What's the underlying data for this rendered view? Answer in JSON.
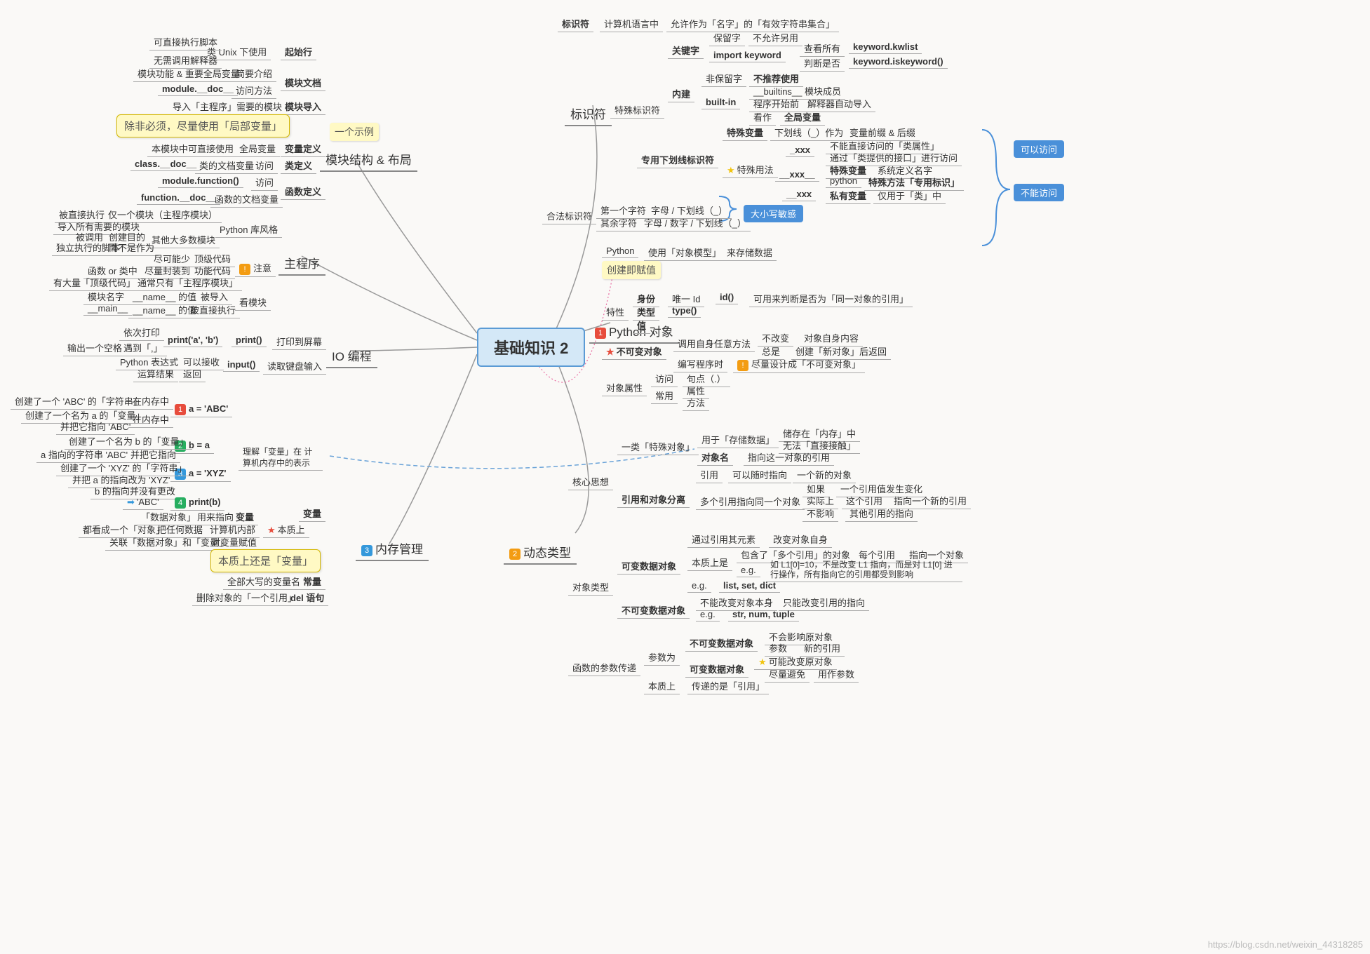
{
  "center": "基础知识 2",
  "watermark": "https://blog.csdn.net/weixin_44318285",
  "left": {
    "module": {
      "label": "模块结构 & 布局",
      "example": "一个示例",
      "local_var_callout": "除非必须，尽量使用「局部变量」",
      "start_line": {
        "label": "起始行",
        "unix": "类 Unix 下使用",
        "exec": "可直接执行脚本",
        "no_interp": "无需调用解释器"
      },
      "module_doc": {
        "label": "模块文档",
        "func_intro": "简要介绍",
        "func_scope": "模块功能 & 重要全局变量",
        "access": "访问方法",
        "module_doc_attr": "module.__doc__"
      },
      "module_import": {
        "label": "模块导入",
        "desc": "导入「主程序」需要的模块"
      },
      "var_def": {
        "label": "变量定义",
        "global": "全局变量",
        "use": "本模块中可直接使用"
      },
      "class_def": {
        "label": "类定义",
        "access_lbl": "访问",
        "class_doc": "class.__doc__",
        "class_doc_desc": "类的文档变量"
      },
      "func_def": {
        "label": "函数定义",
        "module_func": "module.function()",
        "module_func_access": "访问",
        "func_doc": "function.__doc__",
        "func_doc_desc": "函数的文档变量"
      }
    },
    "main": {
      "label": "主程序",
      "style": {
        "label": "Python 库风格",
        "main_mod": "仅一个模块（主程序模块）",
        "direct_exec": "被直接执行",
        "import_all": "导入所有需要的模块",
        "other_mod": "其他大多数模块",
        "called": "被调用",
        "purpose": "创建目的",
        "not_as": "而不是作为",
        "standalone": "独立执行的脚本"
      },
      "note": {
        "label": "注意",
        "toplevel": "顶级代码",
        "as_few": "尽可能少",
        "func_code": "功能代码",
        "wrap": "尽量封装到",
        "func_or_class": "函数 or 类中",
        "only_main": "通常只有「主程序模块」",
        "lots_top": "有大量「顶级代码」"
      },
      "see_mod": {
        "label": "看模块",
        "name_val": "__name__ 的值",
        "mod_name": "模块名字",
        "imported": "被导入",
        "main_name": "__main__",
        "name_val2": "__name__ 的值",
        "direct": "被直接执行"
      }
    },
    "io": {
      "label": "IO 编程",
      "print_screen": "打印到屏幕",
      "print_fn": "print()",
      "print_ab": "print('a', 'b')",
      "seq_print": "依次打印",
      "comma": "遇到「,」",
      "space": "输出一个空格",
      "input": "读取键盘输入",
      "input_fn": "input()",
      "accept": "可以接收",
      "py_expr": "Python 表达式",
      "ret": "返回",
      "calc_result": "运算结果"
    },
    "memory": {
      "label": "内存管理",
      "var": {
        "label": "变量",
        "subtitle": "理解「变量」在\n计算机内存中的表示",
        "s1": "a = 'ABC'",
        "s1a": "在内存中",
        "s1b": "创建了一个 'ABC' 的「字符串」",
        "s1c": "在内存中",
        "s1d": "创建了一个名为 a 的「变量」",
        "s1e": "并把它指向 'ABC'",
        "s2": "b = a",
        "s2a": "创建了一个名为 b 的「变量」",
        "s2b": "并把它指向",
        "s2c": "a 指向的字符串 'ABC'",
        "s3": "a = 'XYZ'",
        "s3a": "创建了一个 'XYZ' 的「字符串」",
        "s3b": "并把 a 的指向改为 'XYZ'",
        "s3c": "b 的指向并没有更改",
        "s4": "print(b)",
        "s4a": "'ABC'",
        "essence": "本质上",
        "essence_callout": "本质上还是「变量」",
        "e1": "变量",
        "e1a": "用来指向",
        "e1b": "「数据对象」",
        "e2": "计算机内部",
        "e2a": "把任何数据",
        "e2b": "都看成一个「对象」",
        "e3": "对变量赋值",
        "e3a": "关联「数据对象」和「变量」"
      },
      "const": {
        "label": "常量",
        "desc": "全部大写的变量名"
      },
      "del": {
        "label": "del 语句",
        "desc": "删除对象的「一个引用」"
      }
    }
  },
  "right": {
    "identifier": {
      "label": "标识符",
      "def": "标识符",
      "def2": "计算机语言中",
      "def3": "允许作为「名字」的「有效字符串集合」",
      "special": {
        "label": "特殊标识符",
        "keyword": {
          "label": "关键字",
          "reserved": "保留字",
          "no_reuse": "不允许另用",
          "import_kw": "import keyword",
          "view_all": "查看所有",
          "kwlist": "keyword.kwlist",
          "judge": "判断是否",
          "iskw": "keyword.iskeyword()"
        },
        "builtin": {
          "label": "内建",
          "not_reserved": "非保留字",
          "not_recommend": "不推荐使用",
          "builtins_member": "__builtins__ 模块成员",
          "bi": "built-in",
          "before_start": "程序开始前",
          "auto_import": "解释器自动导入",
          "treat_as": "看作",
          "global_var": "全局变量"
        },
        "underscore": {
          "label": "专用下划线标识符",
          "special_var": "特殊变量",
          "underscore_as": "下划线（_）作为",
          "prefix_suffix": "变量前缀 & 后缀",
          "special_use": "特殊用法",
          "xxx1": "_xxx",
          "xxx1a": "不能直接访问的「类属性」",
          "xxx1b": "通过「类提供的接口」进行访问",
          "xxx2": "__xxx__",
          "xxx2a": "特殊变量",
          "xxx2a2": "系统定义名字",
          "xxx2b": "python",
          "xxx2b2": "特殊方法「专用标识」",
          "xxx3": "__xxx",
          "xxx3a": "私有变量",
          "xxx3b": "仅用于「类」中"
        }
      },
      "legal": {
        "label": "合法标识符",
        "first": "第一个字符",
        "first_val": "字母 / 下划线（_）",
        "rest": "其余字符",
        "rest_val": "字母 / 数字 / 下划线（_）"
      },
      "case_sensitive": "大小写敏感",
      "can_access": "可以访问",
      "cannot_access": "不能访问"
    },
    "pyobj": {
      "label": "Python 对象",
      "create_assign": "创建即赋值",
      "python_uses": "Python",
      "use": "使用「对象模型」",
      "store": "来存储数据",
      "traits": {
        "label": "特性",
        "identity": "身份",
        "unique_id": "唯一 Id",
        "id_fn": "id()",
        "id_desc": "可用来判断是否为「同一对象的引用」",
        "type": "类型",
        "type_fn": "type()",
        "value": "值"
      },
      "immutable": {
        "label": "不可变对象",
        "call_own": "调用自身任意方法",
        "no_change": "不改变",
        "obj_self": "对象自身内容",
        "always": "总是",
        "create_new": "创建「新对象」后返回",
        "write_prog": "编写程序时",
        "design": "尽量设计成「不可变对象」"
      },
      "attrs": {
        "label": "对象属性",
        "access": "访问",
        "dot": "句点（.）",
        "common": "常用",
        "attr": "属性",
        "method": "方法"
      }
    },
    "dynamic": {
      "label": "动态类型",
      "core": {
        "label": "核心思想",
        "special_obj": "一类「特殊对象」",
        "for_store": "用于「存储数据」",
        "in_mem": "储存在「内存」中",
        "no_direct": "无法「直接接触」",
        "obj_name": "对象名",
        "ref_to": "指向这一对象的引用",
        "sep": "引用和对象分离",
        "ref": "引用",
        "can_point": "可以随时指向",
        "new_obj": "一个新的对象",
        "multi_ref": "多个引用指向同一个对象",
        "if_one": "如果",
        "one_change": "一个引用值发生变化",
        "actually": "实际上",
        "this_ref": "这个引用",
        "point_new": "指向一个新的引用",
        "no_affect": "不影响",
        "other_ref": "其他引用的指向"
      },
      "obj_type": {
        "label": "对象类型",
        "mutable": {
          "label": "可变数据对象",
          "via_elem": "通过引用其元素",
          "change_self": "改变对象自身",
          "essence": "本质上是",
          "contains": "包含了「多个引用」的对象",
          "each_ref": "每个引用",
          "point_one": "指向一个对象",
          "eg1": "e.g.",
          "eg1_desc": "如 L1[0]=10，不是改变 L1 指向，而是对 L1[0] 进行操作，所有指向它的引用都受到影响",
          "eg2": "e.g.",
          "eg2_val": "list, set, dict"
        },
        "immutable": {
          "label": "不可变数据对象",
          "cannot": "不能改变对象本身",
          "only_change_ref": "只能改变引用的指向",
          "eg": "e.g.",
          "eg_val": "str, num, tuple"
        }
      },
      "func_args": {
        "label": "函数的参数传递",
        "param_is": "参数为",
        "immut": "不可变数据对象",
        "no_affect": "不会影响原对象",
        "param": "参数",
        "new_ref": "新的引用",
        "mut": "可变数据对象",
        "may_change": "可能改变原对象",
        "avoid": "尽量避免",
        "as_param": "用作参数",
        "essence": "本质上",
        "pass_ref": "传递的是「引用」"
      }
    }
  }
}
